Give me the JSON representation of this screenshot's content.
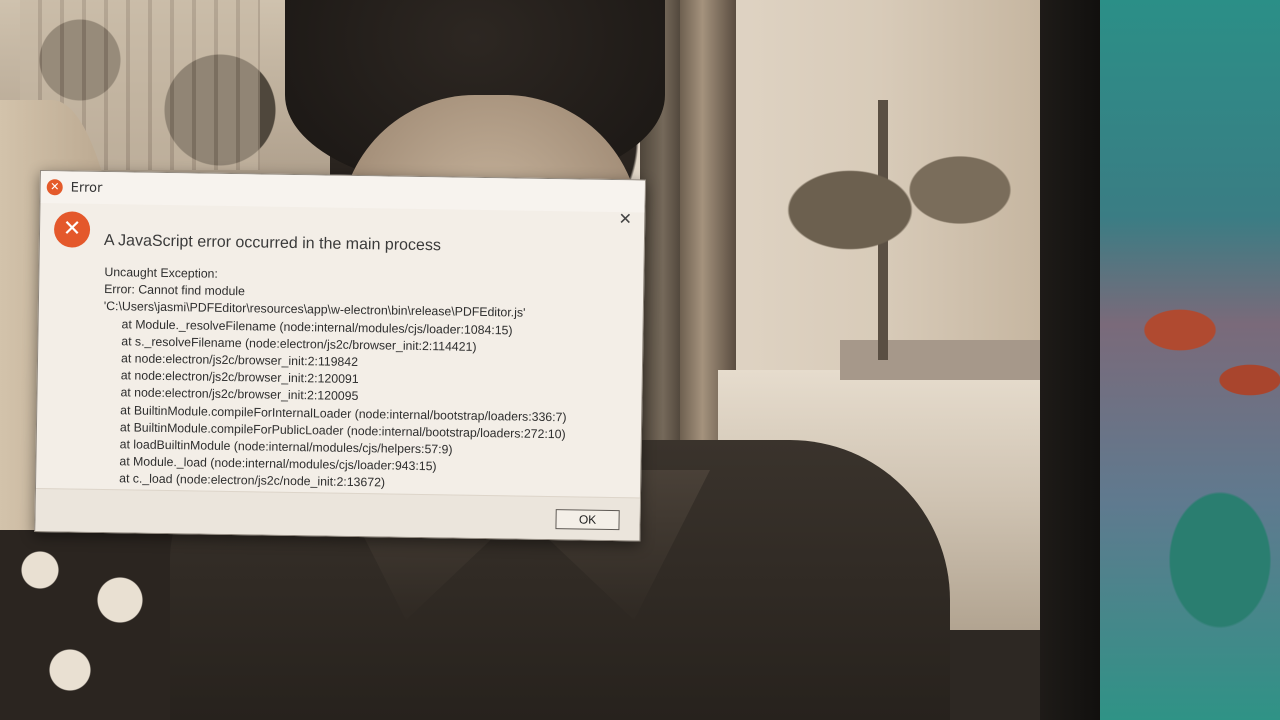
{
  "dialog": {
    "title": "Error",
    "close_glyph": "✕",
    "headline": "A JavaScript error occurred in the main process",
    "lines": [
      "Uncaught Exception:",
      "Error: Cannot find module",
      "'C:\\Users\\jasmi\\PDFEditor\\resources\\app\\w-electron\\bin\\release\\PDFEditor.js'"
    ],
    "stack": [
      "at Module._resolveFilename (node:internal/modules/cjs/loader:1084:15)",
      "at s._resolveFilename (node:electron/js2c/browser_init:2:114421)",
      "at node:electron/js2c/browser_init:2:119842",
      "at node:electron/js2c/browser_init:2:120091",
      "at node:electron/js2c/browser_init:2:120095",
      "at BuiltinModule.compileForInternalLoader (node:internal/bootstrap/loaders:336:7)",
      "at BuiltinModule.compileForPublicLoader (node:internal/bootstrap/loaders:272:10)",
      "at loadBuiltinModule (node:internal/modules/cjs/helpers:57:9)",
      "at Module._load (node:internal/modules/cjs/loader:943:15)",
      "at c._load (node:electron/js2c/node_init:2:13672)"
    ],
    "ok_label": "OK",
    "icon_glyph": "✕",
    "icon_name": "error-icon",
    "accent_color": "#e4582b"
  }
}
